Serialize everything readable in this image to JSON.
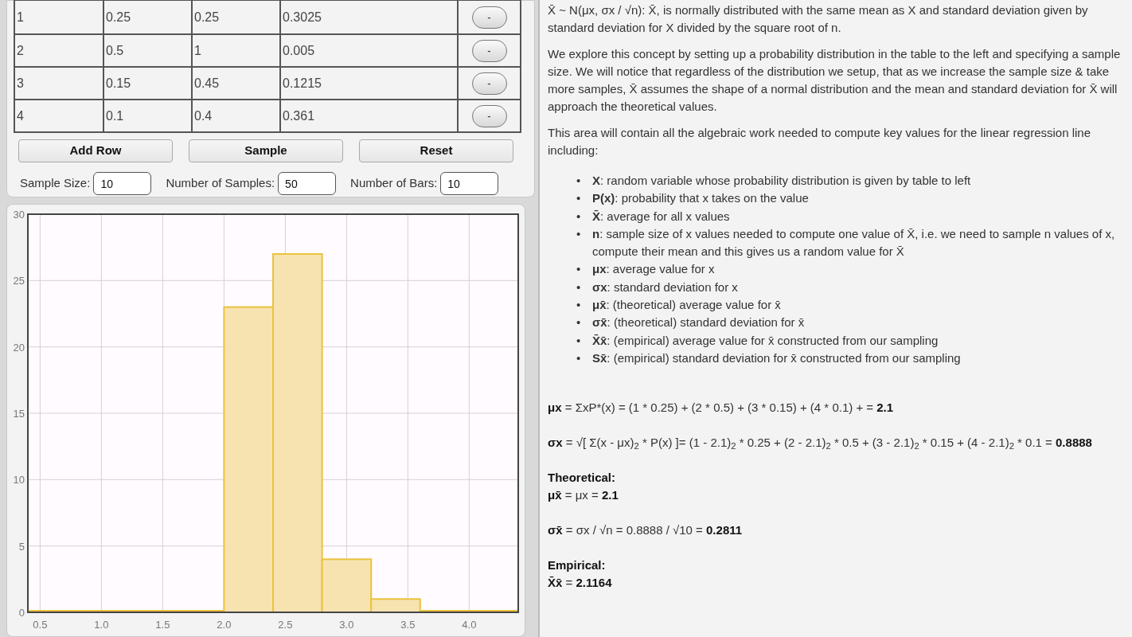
{
  "table": {
    "rows": [
      {
        "cells": [
          "1",
          "0.25",
          "0.25",
          "0.3025"
        ],
        "remove": "-"
      },
      {
        "cells": [
          "2",
          "0.5",
          "1",
          "0.005"
        ],
        "remove": "-"
      },
      {
        "cells": [
          "3",
          "0.15",
          "0.45",
          "0.1215"
        ],
        "remove": "-"
      },
      {
        "cells": [
          "4",
          "0.1",
          "0.4",
          "0.361"
        ],
        "remove": "-"
      }
    ]
  },
  "buttons": [
    "Add Row",
    "Sample",
    "Reset"
  ],
  "fields": [
    {
      "label": "Sample Size:",
      "value": "10"
    },
    {
      "label": "Number of Samples:",
      "value": "50"
    },
    {
      "label": "Number of Bars:",
      "value": "10"
    }
  ],
  "chart_data": {
    "type": "bar",
    "x": [
      0.6,
      1.0,
      1.4,
      1.8,
      2.2,
      2.6,
      3.0,
      3.4,
      3.8,
      4.2
    ],
    "grid": true,
    "series": [
      {
        "color": "#f7e3b0",
        "values": [
          0,
          0,
          0,
          0,
          23,
          27,
          4,
          1,
          0,
          0
        ]
      }
    ],
    "xlim": [
      0.4,
      4.4
    ],
    "ylim": [
      0,
      30
    ],
    "xticks": [
      {
        "value": 0.5,
        "label": "0.5"
      },
      {
        "value": 1,
        "label": "1.0"
      },
      {
        "value": 1.5,
        "label": "1.5"
      },
      {
        "value": 2,
        "label": "2.0"
      },
      {
        "value": 2.5,
        "label": "2.5"
      },
      {
        "value": 3,
        "label": "3.0"
      },
      {
        "value": 3.5,
        "label": "3.5"
      },
      {
        "value": 4,
        "label": "4.0"
      }
    ],
    "yticks": [
      0,
      5,
      10,
      15,
      20,
      25,
      30
    ]
  },
  "explanation": {
    "paragraphs": [
      "X̄ ~ N(μx, σx / √n): X̄, is normally distributed with the same mean as X and standard deviation given by standard deviation for X divided by the square root of n.",
      "We explore this concept by setting up a probability distribution in the table to the left and specifying a sample size. We will notice that regardless of the distribution we setup, that as we increase the sample size & take more samples, X̄ assumes the shape of a normal distribution and the mean and standard deviation for X̄ will approach the theoretical values.",
      "This area will contain all the algebraic work needed to compute key values for the linear regression line including:"
    ],
    "bullets": [
      {
        "marker": "•",
        "text": "**X**: random variable whose probability distribution is given by table to left"
      },
      {
        "marker": "•",
        "text": "**P(x)**: probability that x takes on the value"
      },
      {
        "marker": "•",
        "text": "**X̄**: average for all x values"
      },
      {
        "marker": "•",
        "text": "**n**: sample size of x values needed to compute one value of X̄, i.e. we need to sample n values of x, compute their mean and this gives us a random value for X̄"
      },
      {
        "marker": "•",
        "text": "**μx**: average value for x"
      },
      {
        "marker": "•",
        "text": "**σx**: standard deviation for x"
      },
      {
        "marker": "•",
        "text": "**μx̄**: (theoretical) average value for x̄"
      },
      {
        "marker": "•",
        "text": "**σx̄**: (theoretical) standard deviation for x̄"
      },
      {
        "marker": "•",
        "text": "**X̄x̄**: (empirical) average value for x̄ constructed from our sampling"
      },
      {
        "marker": "•",
        "text": "**Sx̄**: (empirical) standard deviation for x̄ constructed from our sampling"
      }
    ],
    "work": [
      [
        {
          "kind": "formula",
          "text": "**μx** = ΣxP*(x) = (1 * 0.25) + (2 * 0.5) + (3 * 0.15) + (4 * 0.1) + = **2.1**"
        }
      ],
      [
        {
          "kind": "formula",
          "text": "**σx** = √[ Σ(x - μx)$_{2}$ * P(x) ]= (1 - 2.1)$_{2}$ * 0.25 + (2 - 2.1)$_{2}$ * 0.5 + (3 - 2.1)$_{2}$ * 0.15 + (4 - 2.1)$_{2}$ * 0.1 = **0.8888**"
        }
      ],
      [
        {
          "kind": "heading",
          "text": "Theoretical:"
        },
        {
          "kind": "formula",
          "text": "**μx̄** = μx = **2.1**"
        }
      ],
      [
        {
          "kind": "formula",
          "text": "**σx̄** = σx / √n = 0.8888 / √10 = **0.2811**"
        }
      ],
      [
        {
          "kind": "heading",
          "text": "Empirical:"
        },
        {
          "kind": "formula",
          "text": "**X̄x̄** = **2.1164**"
        }
      ]
    ]
  }
}
